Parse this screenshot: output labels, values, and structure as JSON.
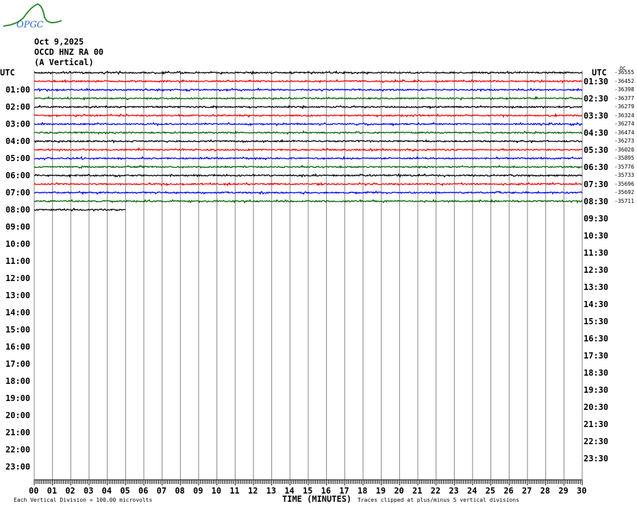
{
  "logo": {
    "text": "OPGC"
  },
  "header": {
    "date": "Oct 9,2025",
    "station": "OCCD HNZ RA 00",
    "component": "(A Vertical)"
  },
  "chart_data": {
    "type": "line",
    "title": "OCCD HNZ RA 00 (A Vertical)",
    "left_axis_label": "UTC",
    "right_axis_label": "UTC",
    "left_labels": [
      "01:00",
      "02:00",
      "03:00",
      "04:00",
      "05:00",
      "06:00",
      "07:00",
      "08:00",
      "09:00",
      "10:00",
      "11:00",
      "12:00",
      "13:00",
      "14:00",
      "15:00",
      "16:00",
      "17:00",
      "18:00",
      "19:00",
      "20:00",
      "21:00",
      "22:00",
      "23:00"
    ],
    "right_labels": [
      "01:30",
      "02:30",
      "03:30",
      "04:30",
      "05:30",
      "06:30",
      "07:30",
      "08:30",
      "09:30",
      "10:30",
      "11:30",
      "12:30",
      "13:30",
      "14:30",
      "15:30",
      "16:30",
      "17:30",
      "18:30",
      "19:30",
      "20:30",
      "21:30",
      "22:30",
      "23:30"
    ],
    "dc_label": "DC",
    "dc_offsets": [
      "-36555",
      "-36452",
      "-36398",
      "-36377",
      "-36279",
      "-36324",
      "-36274",
      "-36474",
      "-36273",
      "-36020",
      "-35895",
      "-35776",
      "-35733",
      "-35696",
      "-35692",
      "-35711"
    ],
    "x_ticks": [
      "00",
      "01",
      "02",
      "03",
      "04",
      "05",
      "06",
      "07",
      "08",
      "09",
      "10",
      "11",
      "12",
      "13",
      "14",
      "15",
      "16",
      "17",
      "18",
      "19",
      "20",
      "21",
      "22",
      "23",
      "24",
      "25",
      "26",
      "27",
      "28",
      "29",
      "30"
    ],
    "xlabel": "TIME (MINUTES)",
    "xlim": [
      0,
      30
    ],
    "trace_colors": [
      "#000000",
      "#ff0000",
      "#0000ff",
      "#006400"
    ],
    "complete_rows": 16,
    "last_row_minutes": 5,
    "footer_left": "Each Vertical Division =  100.00 microvolts",
    "footer_right": "Traces clipped at plus/minus 5 vertical divisions"
  }
}
